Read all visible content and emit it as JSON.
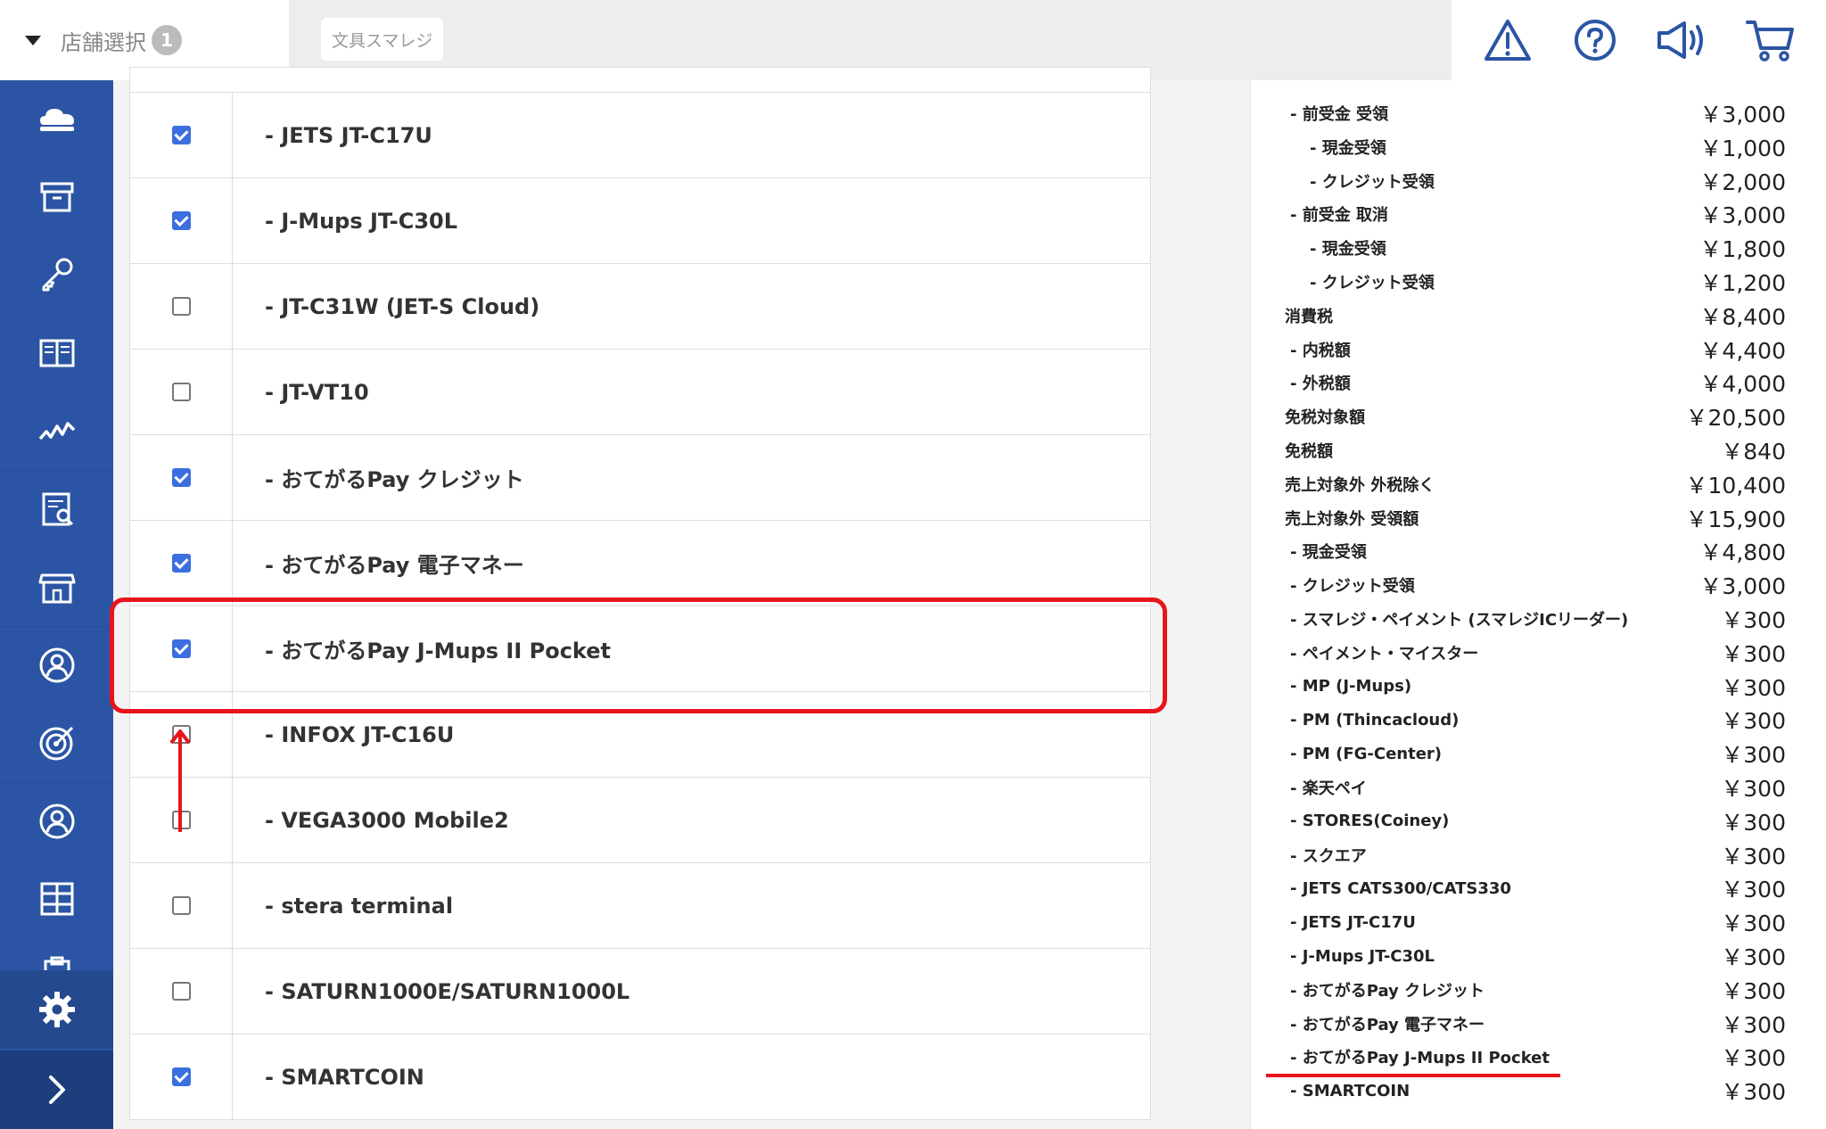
{
  "topbar": {
    "store_select_label": "店舗選択",
    "store_count": "1",
    "store_chip": "文具スマレジ",
    "icons": [
      "warning-icon",
      "help-icon",
      "announcement-icon",
      "cart-icon"
    ]
  },
  "sidebar": {
    "icons": [
      "cloud-icon",
      "archive-icon",
      "key-icon",
      "book-icon",
      "analytics-icon",
      "report-icon",
      "store-icon",
      "member-icon",
      "target-icon",
      "user-icon",
      "grid-icon",
      "clipboard-icon"
    ],
    "settings_icon": "gear-icon",
    "expand_icon": "chevron-right-icon"
  },
  "payment_list": [
    {
      "label": "- JETS JT-C17U",
      "checked": true
    },
    {
      "label": "- J-Mups JT-C30L",
      "checked": true
    },
    {
      "label": "- JT-C31W (JET-S Cloud)",
      "checked": false
    },
    {
      "label": "- JT-VT10",
      "checked": false
    },
    {
      "label": "- おてがるPay クレジット",
      "checked": true
    },
    {
      "label": "- おてがるPay 電子マネー",
      "checked": true
    },
    {
      "label": "- おてがるPay J-Mups II Pocket",
      "checked": true
    },
    {
      "label": "- INFOX JT-C16U",
      "checked": false
    },
    {
      "label": "- VEGA3000 Mobile2",
      "checked": false
    },
    {
      "label": "- stera terminal",
      "checked": false
    },
    {
      "label": "- SATURN1000E/SATURN1000L",
      "checked": false
    },
    {
      "label": "- SMARTCOIN",
      "checked": true
    }
  ],
  "summary": [
    {
      "name": "- 前受金 受領",
      "value": "￥3,000",
      "indent": 1
    },
    {
      "name": "- 現金受領",
      "value": "￥1,000",
      "indent": 2
    },
    {
      "name": "- クレジット受領",
      "value": "￥2,000",
      "indent": 2
    },
    {
      "name": "- 前受金 取消",
      "value": "￥3,000",
      "indent": 1
    },
    {
      "name": "- 現金受領",
      "value": "￥1,800",
      "indent": 2
    },
    {
      "name": "- クレジット受領",
      "value": "￥1,200",
      "indent": 2
    },
    {
      "name": "消費税",
      "value": "￥8,400",
      "indent": 0
    },
    {
      "name": "- 内税額",
      "value": "￥4,400",
      "indent": 1
    },
    {
      "name": "- 外税額",
      "value": "￥4,000",
      "indent": 1
    },
    {
      "name": "免税対象額",
      "value": "￥20,500",
      "indent": 0
    },
    {
      "name": "免税額",
      "value": "￥840",
      "indent": 0
    },
    {
      "name": "売上対象外 外税除く",
      "value": "￥10,400",
      "indent": 0
    },
    {
      "name": "売上対象外 受領額",
      "value": "￥15,900",
      "indent": 0
    },
    {
      "name": "- 現金受領",
      "value": "￥4,800",
      "indent": 1
    },
    {
      "name": "- クレジット受領",
      "value": "￥3,000",
      "indent": 1
    },
    {
      "name": "- スマレジ・ペイメント (スマレジICリーダー)",
      "value": "￥300",
      "indent": 1
    },
    {
      "name": "- ペイメント・マイスター",
      "value": "￥300",
      "indent": 1
    },
    {
      "name": "- MP (J-Mups)",
      "value": "￥300",
      "indent": 1
    },
    {
      "name": "- PM (Thincacloud)",
      "value": "￥300",
      "indent": 1
    },
    {
      "name": "- PM (FG-Center)",
      "value": "￥300",
      "indent": 1
    },
    {
      "name": "- 楽天ペイ",
      "value": "￥300",
      "indent": 1
    },
    {
      "name": "- STORES(Coiney)",
      "value": "￥300",
      "indent": 1
    },
    {
      "name": "- スクエア",
      "value": "￥300",
      "indent": 1
    },
    {
      "name": "- JETS CATS300/CATS330",
      "value": "￥300",
      "indent": 1
    },
    {
      "name": "- JETS JT-C17U",
      "value": "￥300",
      "indent": 1
    },
    {
      "name": "- J-Mups JT-C30L",
      "value": "￥300",
      "indent": 1
    },
    {
      "name": "- おてがるPay クレジット",
      "value": "￥300",
      "indent": 1
    },
    {
      "name": "- おてがるPay 電子マネー",
      "value": "￥300",
      "indent": 1
    },
    {
      "name": "- おてがるPay J-Mups II Pocket",
      "value": "￥300",
      "indent": 1
    },
    {
      "name": "- SMARTCOIN",
      "value": "￥300",
      "indent": 1
    }
  ]
}
